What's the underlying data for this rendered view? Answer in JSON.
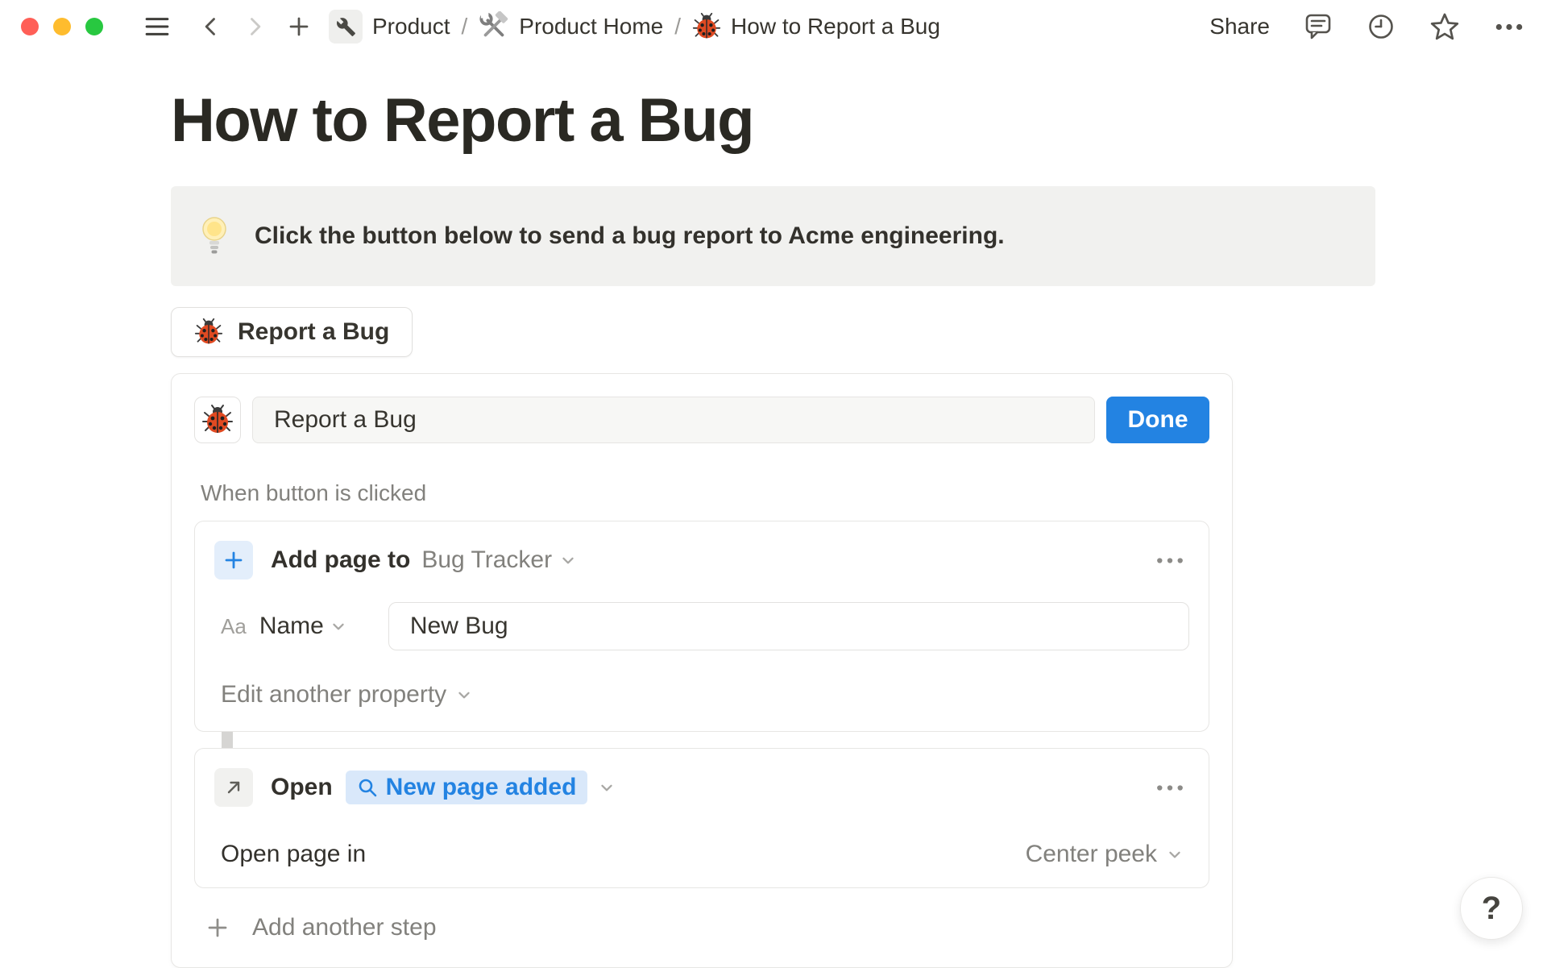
{
  "topbar": {
    "separator": "/",
    "breadcrumb": [
      {
        "icon": "wrench-icon",
        "label": "Product"
      },
      {
        "icon": "hammer-wrench-icon",
        "label": "Product Home"
      },
      {
        "icon": "ladybug-icon",
        "label": "How to Report a Bug"
      }
    ],
    "share_label": "Share",
    "right_icons": [
      "comments-icon",
      "history-clock-icon",
      "favorite-star-icon",
      "more-options-icon"
    ]
  },
  "page": {
    "title": "How to Report a Bug"
  },
  "callout": {
    "icon": "light-bulb-icon",
    "text": "Click the button below to send a bug report to Acme engineering."
  },
  "bug_button": {
    "icon": "ladybug-icon",
    "label": "Report a Bug"
  },
  "button_editor": {
    "icon": "ladybug-icon",
    "name_value": "Report a Bug",
    "done_label": "Done",
    "trigger_label": "When button is clicked",
    "steps": [
      {
        "icon": "plus-icon",
        "action": "Add page to",
        "target": "Bug Tracker",
        "menu": "•••",
        "property_type": "Aa",
        "property_name": "Name",
        "property_value": "New Bug",
        "edit_another_label": "Edit another property"
      },
      {
        "icon": "arrow-up-right-icon",
        "action": "Open",
        "target": "New page added",
        "target_icon": "search-icon",
        "menu": "•••",
        "open_page_in_label": "Open page in",
        "open_page_in_value": "Center peek"
      }
    ],
    "add_step_label": "Add another step"
  },
  "help_button": {
    "label": "?"
  },
  "colors": {
    "accent_blue": "#2383e2",
    "pill_bg": "#d9e8fa",
    "callout_bg": "#f1f1ef",
    "text_dark": "#32302c",
    "text_gray": "#82817d",
    "done_bg": "#2383e2"
  }
}
